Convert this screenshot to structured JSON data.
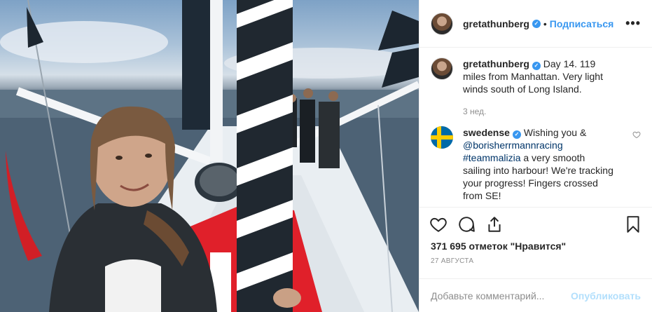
{
  "post": {
    "username": "gretathunberg",
    "follow_label": "Подписаться",
    "dot": "•",
    "more_label": "•••",
    "caption": "Day 14. 119 miles from Manhattan. Very light winds south of Long Island.",
    "caption_time": "3 нед.",
    "likes": "371 695 отметок \"Нравится\"",
    "date": "27 АВГУСТА"
  },
  "comments": [
    {
      "username": "swedense",
      "text_before": "Wishing you & ",
      "mention": "@borisherrmannracing",
      "hashtag": "#teammalizia",
      "text_after": " a very smooth sailing into harbour! We're tracking your progress! Fingers crossed from SE!"
    }
  ],
  "add_comment": {
    "placeholder": "Добавьте комментарий...",
    "publish_label": "Опубликовать"
  },
  "icons": [
    "heart-icon",
    "comment-icon",
    "share-icon",
    "bookmark-icon",
    "verified-badge-icon",
    "more-options-icon"
  ],
  "colors": {
    "accent": "#3897f0",
    "publish_disabled": "#b2dffc",
    "muted": "#8e8e8e",
    "hashtag": "#003569"
  }
}
